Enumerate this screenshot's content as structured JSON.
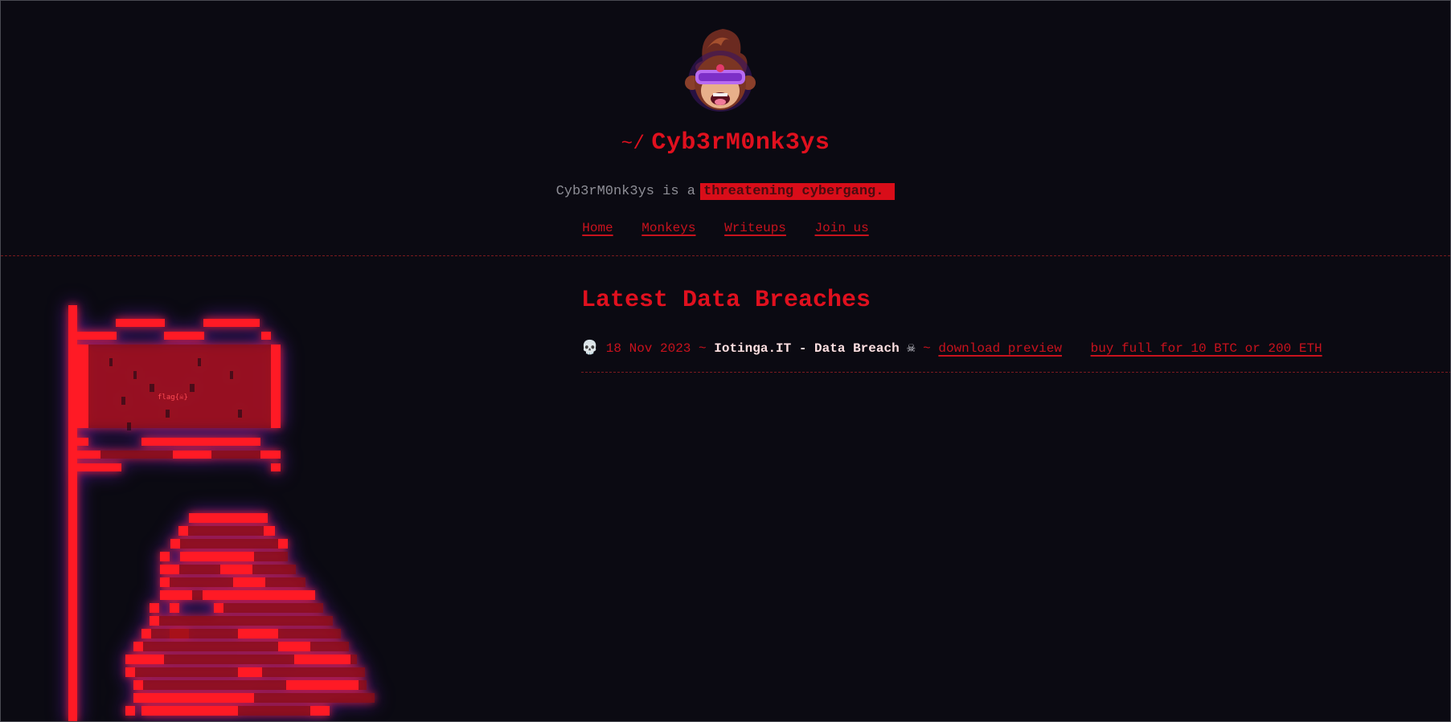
{
  "header": {
    "title_prefix": "~/",
    "title": "Cyb3rM0nk3ys",
    "tagline_text": "Cyb3rM0nk3ys is a",
    "tagline_highlight": "threatening cybergang.",
    "avatar_icon": "monkey-vr-avatar-icon"
  },
  "nav": {
    "items": [
      {
        "label": "Home"
      },
      {
        "label": "Monkeys"
      },
      {
        "label": "Writeups"
      },
      {
        "label": "Join us"
      }
    ]
  },
  "art": {
    "flag_text": "flag{☠}",
    "icon": "pixel-flag-monkey-icon"
  },
  "breaches": {
    "title": "Latest Data Breaches",
    "items": [
      {
        "skull_icon": "💀",
        "date": "18 Nov 2023",
        "sep1": "~",
        "name": "Iotinga.IT - Data Breach",
        "crossbones_icon": "☠",
        "sep2": "~",
        "preview_label": "download preview",
        "buy_label": "buy full for 10 BTC or 200 ETH"
      }
    ]
  },
  "colors": {
    "background": "#0b0a12",
    "accent_red": "#e0101e",
    "muted_text": "#8e8e96",
    "glow_purple": "#8c28ff"
  }
}
